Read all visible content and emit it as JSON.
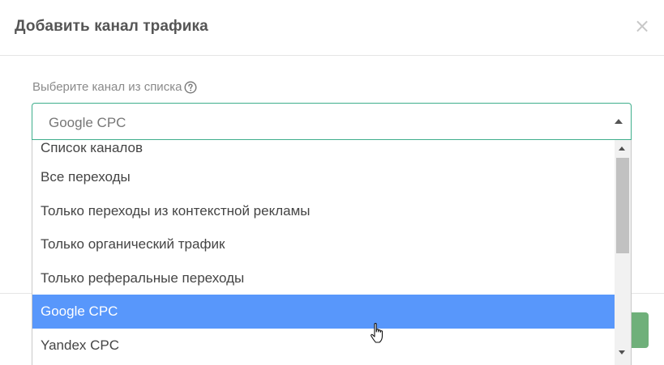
{
  "modal": {
    "title": "Добавить канал трафика",
    "close_glyph": "×"
  },
  "field": {
    "label": "Выберите канал из списка",
    "selected_value": "Google CPC"
  },
  "dropdown": {
    "options": [
      {
        "label": "Список каналов"
      },
      {
        "label": "Все переходы"
      },
      {
        "label": "Только переходы из контекстной рекламы"
      },
      {
        "label": "Только органический трафик"
      },
      {
        "label": "Только реферальные переходы"
      },
      {
        "label": "Google CPC"
      },
      {
        "label": "Yandex CPC"
      }
    ],
    "highlighted_index": 5
  },
  "colors": {
    "select_border": "#3fae8c",
    "highlight": "#5897fb",
    "primary_button": "#6fb07a"
  },
  "icons": {
    "help": "question-circle-icon",
    "close": "close-icon",
    "select_arrow": "caret-up-icon",
    "cursor": "hand-pointer-icon"
  }
}
